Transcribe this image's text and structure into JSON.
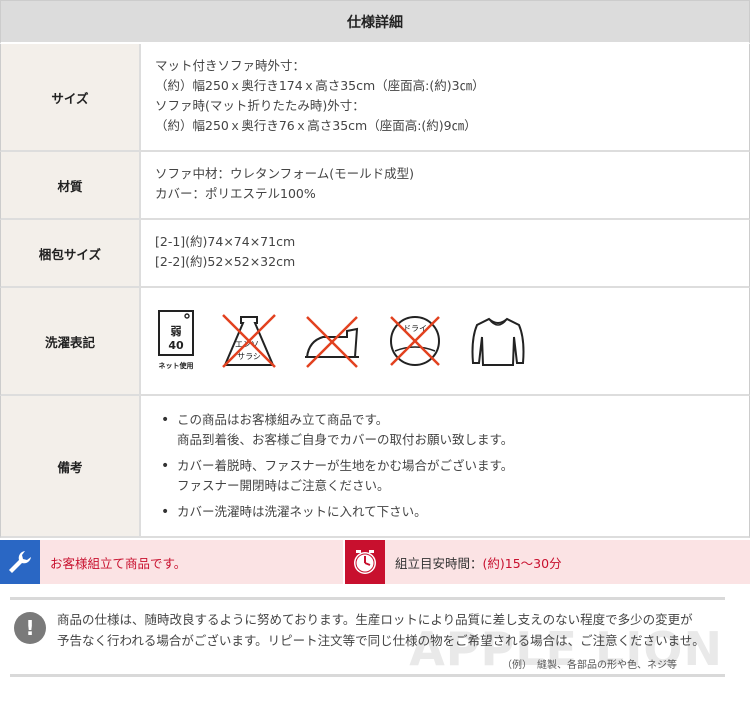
{
  "header": {
    "title": "仕様詳細"
  },
  "rows": {
    "size": {
      "label": "サイズ",
      "lines": [
        "マット付きソファ時外寸：",
        "（約）幅250ｘ奥行き174ｘ高さ35cm（座面高:(約)3㎝）",
        "ソファ時(マット折りたたみ時)外寸：",
        "（約）幅250ｘ奥行き76ｘ高さ35cm（座面高:(約)9㎝）"
      ]
    },
    "material": {
      "label": "材質",
      "lines": [
        "ソファ中材：ウレタンフォーム(モールド成型)",
        "カバー：ポリエステル100%"
      ]
    },
    "package": {
      "label": "梱包サイズ",
      "lines": [
        "[2-1](約)74×74×71cm",
        "[2-2](約)52×52×32cm"
      ]
    },
    "wash": {
      "label": "洗濯表記",
      "tub_text_top": "弱",
      "tub_text_num": "40",
      "tub_caption": "ネット使用",
      "bleach_text_1": "エンソ",
      "bleach_text_2": "サラシ",
      "dry_text": "ドライ"
    },
    "notes": {
      "label": "備考",
      "items": [
        {
          "l1": "この商品はお客様組み立て商品です。",
          "l2": "商品到着後、お客様ご自身でカバーの取付お願い致します。"
        },
        {
          "l1": "カバー着脱時、ファスナーが生地をかむ場合がございます。",
          "l2": "ファスナー開閉時はご注意ください。"
        },
        {
          "l1": "カバー洗濯時は洗濯ネットに入れて下さい。",
          "l2": ""
        }
      ]
    }
  },
  "banner": {
    "assembly_text": "お客様組立て商品です。",
    "time_label": "組立目安時間：",
    "time_value": "(約)15～30分",
    "colors": {
      "blue": "#2a67c4",
      "red": "#c8102e",
      "bg": "#fbe3e4"
    }
  },
  "notice": {
    "line1": "商品の仕様は、随時改良するように努めております。生産ロットにより品質に差し支えのない程度で多少の変更が",
    "line2": "予告なく行われる場合がございます。リピート注文等で同じ仕様の物をご希望される場合は、ご注意くださいませ。",
    "small": "（例）　縫製、各部品の形や色、ネジ等",
    "watermark": "APPLE LION"
  }
}
